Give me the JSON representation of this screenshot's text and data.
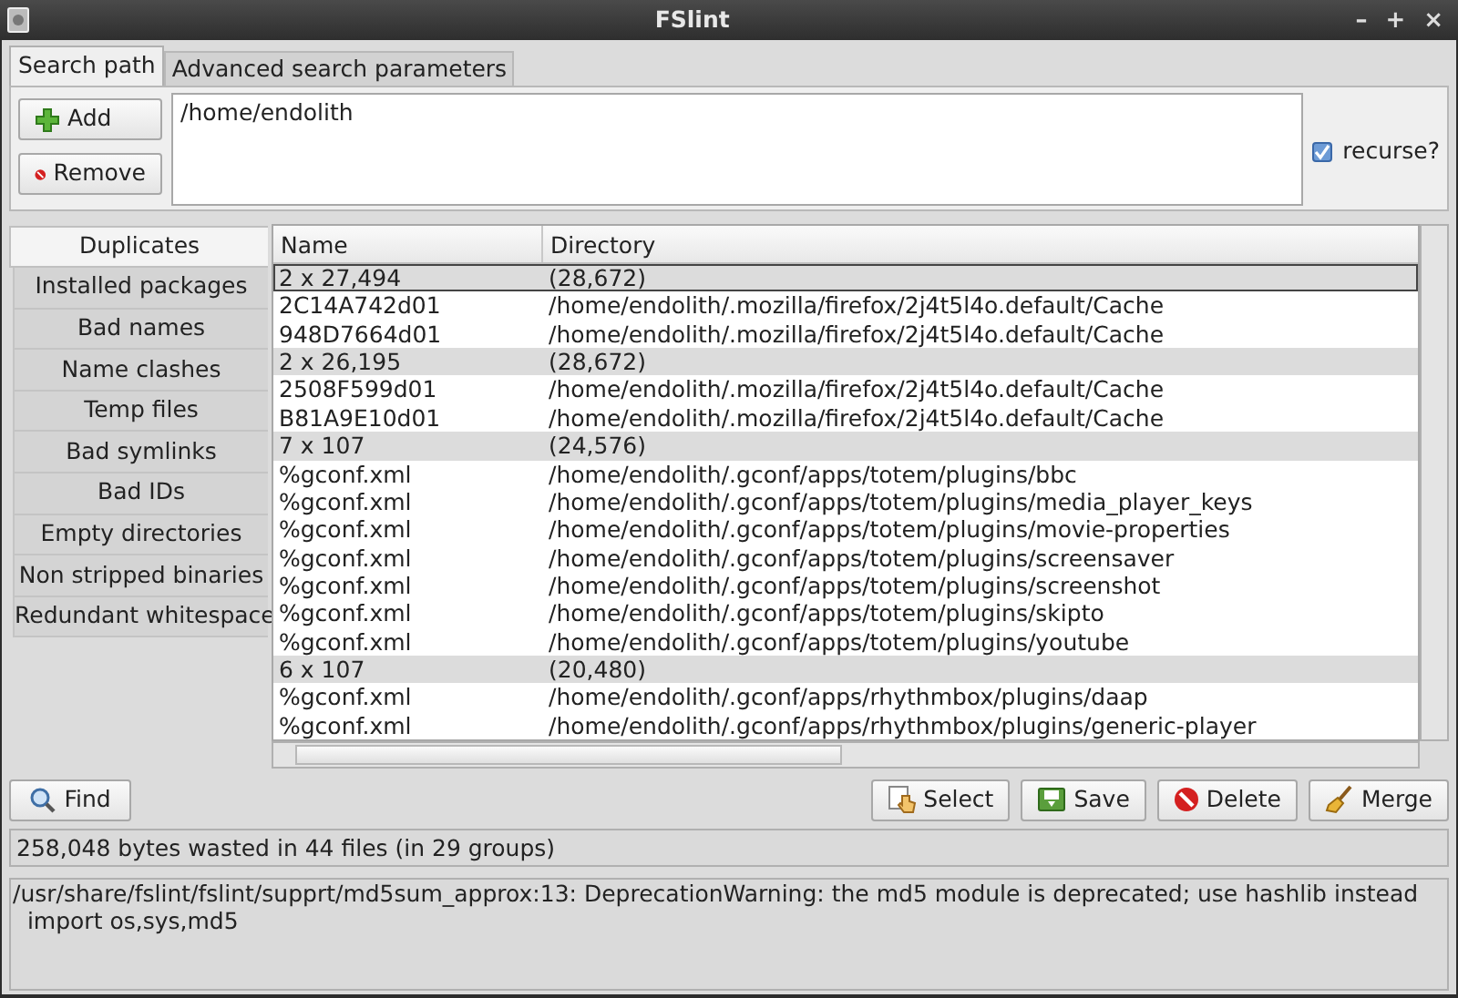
{
  "window": {
    "title": "FSlint",
    "controls": [
      "–",
      "+",
      "×"
    ]
  },
  "tabs": [
    {
      "label": "Search path",
      "selected": true
    },
    {
      "label": "Advanced search parameters",
      "selected": false
    }
  ],
  "path_buttons": [
    {
      "label": "Add",
      "kind": "add"
    },
    {
      "label": "Remove",
      "kind": "remove"
    }
  ],
  "paths": [
    "/home/endolith"
  ],
  "recurse": {
    "label": "recurse?",
    "checked": true
  },
  "sidebar": {
    "items": [
      {
        "label": "Duplicates",
        "selected": true
      },
      {
        "label": "Installed packages",
        "selected": false
      },
      {
        "label": "Bad names",
        "selected": false
      },
      {
        "label": "Name clashes",
        "selected": false
      },
      {
        "label": "Temp files",
        "selected": false
      },
      {
        "label": "Bad symlinks",
        "selected": false
      },
      {
        "label": "Bad IDs",
        "selected": false
      },
      {
        "label": "Empty directories",
        "selected": false
      },
      {
        "label": "Non stripped binaries",
        "selected": false
      },
      {
        "label": "Redundant whitespace",
        "selected": false
      }
    ]
  },
  "table": {
    "columns": [
      "Name",
      "Directory"
    ],
    "rows": [
      {
        "kind": "group",
        "selected": true,
        "cells": [
          "2 x 27,494",
          "(28,672)"
        ]
      },
      {
        "kind": "file",
        "selected": false,
        "cells": [
          "2C14A742d01",
          "/home/endolith/.mozilla/firefox/2j4t5l4o.default/Cache"
        ]
      },
      {
        "kind": "file",
        "selected": false,
        "cells": [
          "948D7664d01",
          "/home/endolith/.mozilla/firefox/2j4t5l4o.default/Cache"
        ]
      },
      {
        "kind": "group",
        "selected": false,
        "cells": [
          "2 x 26,195",
          "(28,672)"
        ]
      },
      {
        "kind": "file",
        "selected": false,
        "cells": [
          "2508F599d01",
          "/home/endolith/.mozilla/firefox/2j4t5l4o.default/Cache"
        ]
      },
      {
        "kind": "file",
        "selected": false,
        "cells": [
          "B81A9E10d01",
          "/home/endolith/.mozilla/firefox/2j4t5l4o.default/Cache"
        ]
      },
      {
        "kind": "group",
        "selected": false,
        "cells": [
          "7 x 107",
          "(24,576)"
        ]
      },
      {
        "kind": "file",
        "selected": false,
        "cells": [
          "%gconf.xml",
          "/home/endolith/.gconf/apps/totem/plugins/bbc"
        ]
      },
      {
        "kind": "file",
        "selected": false,
        "cells": [
          "%gconf.xml",
          "/home/endolith/.gconf/apps/totem/plugins/media_player_keys"
        ]
      },
      {
        "kind": "file",
        "selected": false,
        "cells": [
          "%gconf.xml",
          "/home/endolith/.gconf/apps/totem/plugins/movie-properties"
        ]
      },
      {
        "kind": "file",
        "selected": false,
        "cells": [
          "%gconf.xml",
          "/home/endolith/.gconf/apps/totem/plugins/screensaver"
        ]
      },
      {
        "kind": "file",
        "selected": false,
        "cells": [
          "%gconf.xml",
          "/home/endolith/.gconf/apps/totem/plugins/screenshot"
        ]
      },
      {
        "kind": "file",
        "selected": false,
        "cells": [
          "%gconf.xml",
          "/home/endolith/.gconf/apps/totem/plugins/skipto"
        ]
      },
      {
        "kind": "file",
        "selected": false,
        "cells": [
          "%gconf.xml",
          "/home/endolith/.gconf/apps/totem/plugins/youtube"
        ]
      },
      {
        "kind": "group",
        "selected": false,
        "cells": [
          "6 x 107",
          "(20,480)"
        ]
      },
      {
        "kind": "file",
        "selected": false,
        "cells": [
          "%gconf.xml",
          "/home/endolith/.gconf/apps/rhythmbox/plugins/daap"
        ]
      },
      {
        "kind": "file",
        "selected": false,
        "cells": [
          "%gconf.xml",
          "/home/endolith/.gconf/apps/rhythmbox/plugins/generic-player"
        ]
      }
    ]
  },
  "find_button": {
    "label": "Find"
  },
  "action_buttons": [
    {
      "label": "Select",
      "kind": "select"
    },
    {
      "label": "Save",
      "kind": "save"
    },
    {
      "label": "Delete",
      "kind": "delete"
    },
    {
      "label": "Merge",
      "kind": "merge"
    }
  ],
  "status_bar": "258,048 bytes wasted in 44 files (in 29 groups)",
  "output": [
    "/usr/share/fslint/fslint/supprt/md5sum_approx:13: DeprecationWarning: the md5 module is deprecated; use hashlib instead",
    "  import os,sys,md5"
  ]
}
